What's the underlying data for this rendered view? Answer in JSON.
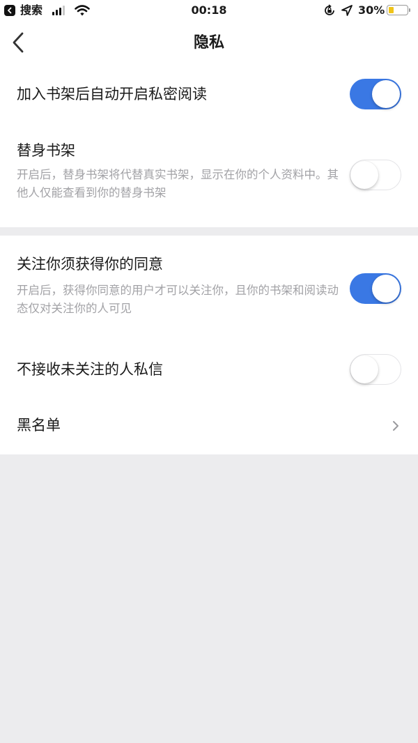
{
  "status_bar": {
    "back_app_label": "搜索",
    "time": "00:18",
    "battery_percent_text": "30%",
    "battery_level": 0.3,
    "signal_bars": 3
  },
  "nav": {
    "title": "隐私"
  },
  "settings": {
    "auto_private_reading": {
      "title": "加入书架后自动开启私密阅读",
      "enabled": true
    },
    "avatar_bookshelf": {
      "title": "替身书架",
      "description": "开启后，替身书架将代替真实书架，显示在你的个人资料中。其他人仅能查看到你的替身书架",
      "enabled": false
    },
    "follow_requires_consent": {
      "title": "关注你须获得你的同意",
      "description": "开启后，获得你同意的用户才可以关注你，且你的书架和阅读动态仅对关注你的人可见",
      "enabled": true
    },
    "no_dm_from_non_followers": {
      "title": "不接收未关注的人私信",
      "enabled": false
    },
    "blacklist": {
      "title": "黑名单"
    }
  },
  "colors": {
    "accent": "#3a78e4",
    "page_background": "#ececee",
    "description_text": "#a2a2a6",
    "battery_fill": "#f0c419"
  },
  "icons": {
    "status_back": "back-to-app-icon",
    "signal": "cellular-signal-icon",
    "wifi": "wifi-icon",
    "orientation_lock": "orientation-lock-icon",
    "location": "location-arrow-icon",
    "battery": "battery-icon",
    "nav_back": "chevron-left-icon",
    "row_arrow": "chevron-right-icon"
  }
}
